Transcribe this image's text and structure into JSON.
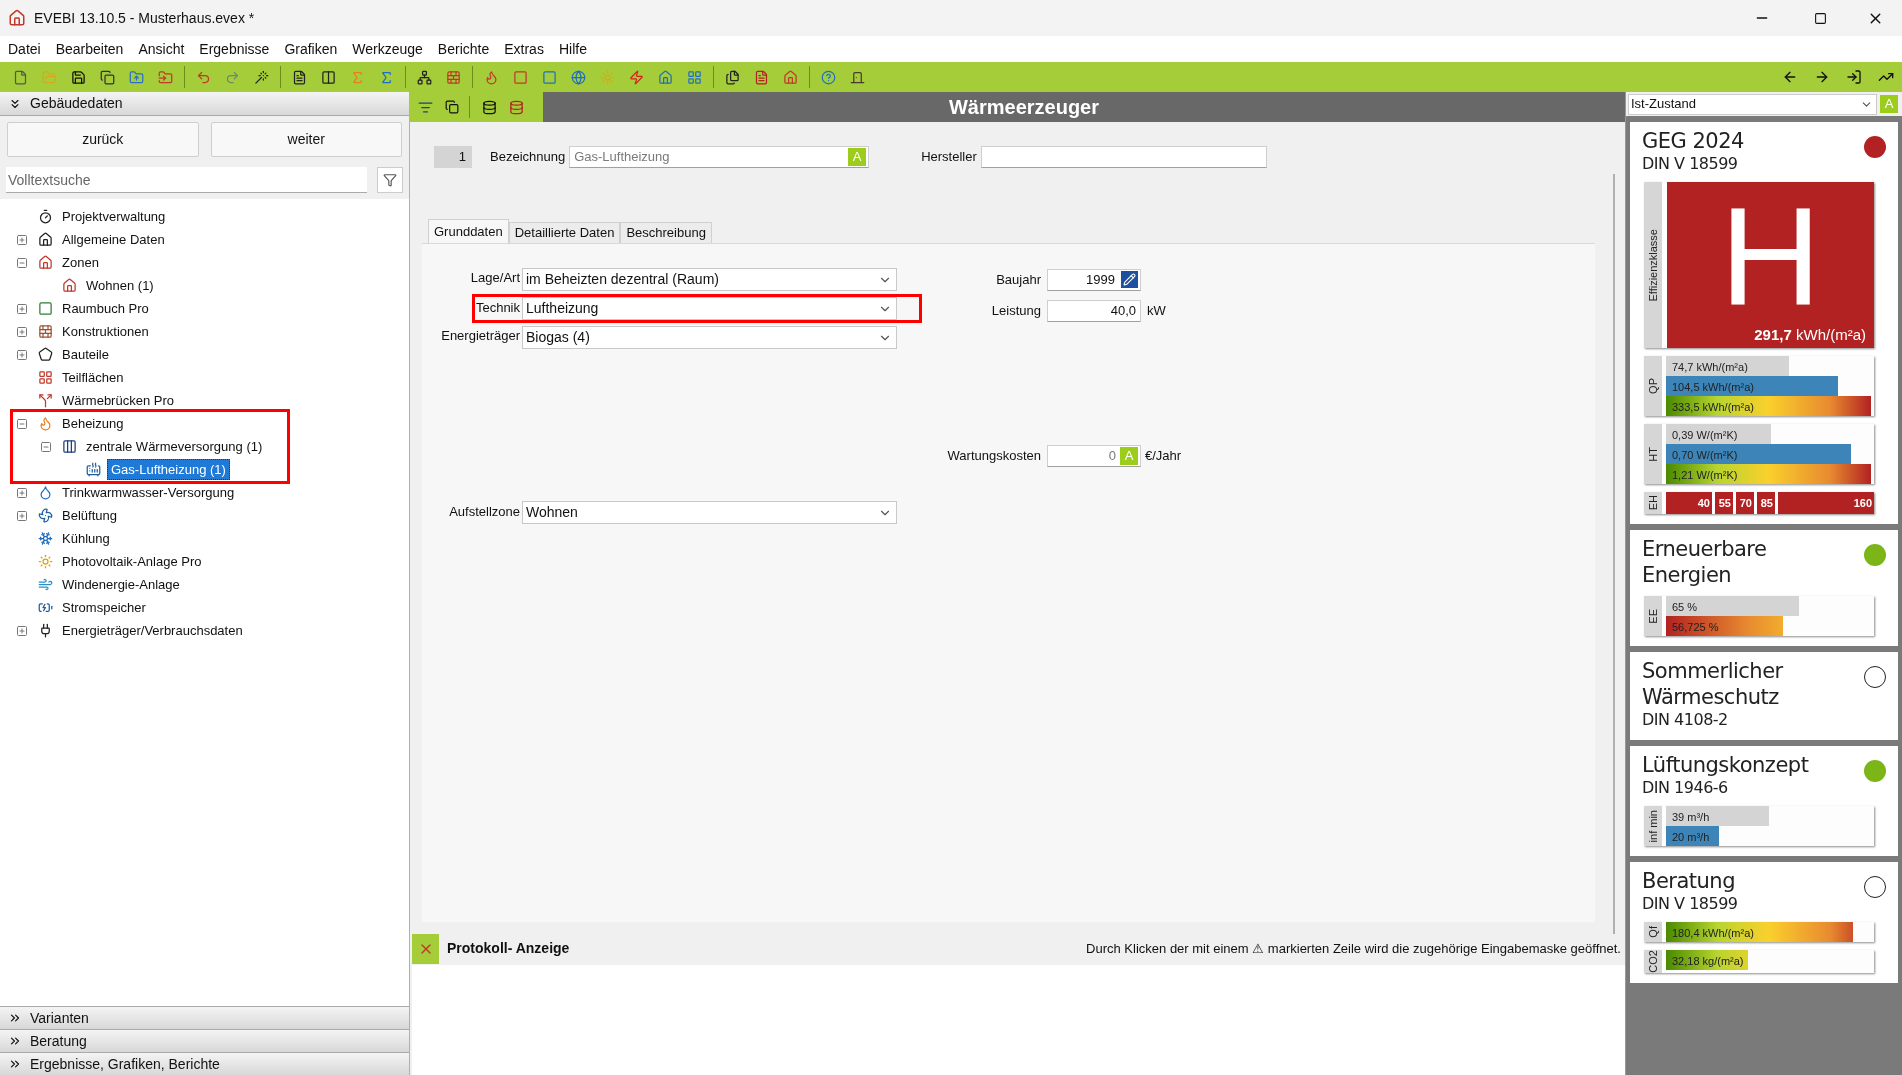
{
  "window": {
    "title": "EVEBI 13.10.5 - Musterhaus.evex *"
  },
  "menu": [
    "Datei",
    "Bearbeiten",
    "Ansicht",
    "Ergebnisse",
    "Grafiken",
    "Werkzeuge",
    "Berichte",
    "Extras",
    "Hilfe"
  ],
  "sidebar": {
    "header": "Gebäudedaten",
    "buttons": [
      "zurück",
      "weiter"
    ],
    "search": {
      "placeholder": "Volltextsuche"
    },
    "tree": [
      {
        "label": "Projektverwaltung",
        "selected": false,
        "highlighted": false
      },
      {
        "label": "Allgemeine Daten",
        "expanded": false,
        "selected": false,
        "highlighted": false
      },
      {
        "label": "Zonen",
        "expanded": true,
        "selected": false,
        "highlighted": false,
        "children": [
          {
            "label": "Wohnen (1)",
            "selected": false,
            "highlighted": false
          }
        ]
      },
      {
        "label": "Raumbuch Pro",
        "expanded": false,
        "selected": false,
        "highlighted": false
      },
      {
        "label": "Konstruktionen",
        "expanded": false,
        "selected": false,
        "highlighted": false
      },
      {
        "label": "Bauteile",
        "expanded": false,
        "selected": false,
        "highlighted": false
      },
      {
        "label": "Teilflächen",
        "selected": false,
        "highlighted": false
      },
      {
        "label": "Wärmebrücken Pro",
        "selected": false,
        "highlighted": false
      },
      {
        "label": "Beheizung",
        "expanded": true,
        "selected": false,
        "highlighted": true,
        "children": [
          {
            "label": "zentrale Wärmeversorgung (1)",
            "expanded": true,
            "selected": false,
            "highlighted": false,
            "children": [
              {
                "label": "Gas-Luftheizung (1)",
                "selected": true,
                "highlighted": false
              }
            ]
          }
        ]
      },
      {
        "label": "Trinkwarmwasser-Versorgung",
        "expanded": false,
        "selected": false,
        "highlighted": false
      },
      {
        "label": "Belüftung",
        "expanded": false,
        "selected": false,
        "highlighted": false
      },
      {
        "label": "Kühlung",
        "selected": false,
        "highlighted": false
      },
      {
        "label": "Photovoltaik-Anlage Pro",
        "selected": false,
        "highlighted": false
      },
      {
        "label": "Windenergie-Anlage",
        "selected": false,
        "highlighted": false
      },
      {
        "label": "Stromspeicher",
        "selected": false,
        "highlighted": false
      },
      {
        "label": "Energieträger/Verbrauchsdaten",
        "expanded": false,
        "selected": false,
        "highlighted": false
      }
    ],
    "sections": [
      "Varianten",
      "Beratung",
      "Ergebnisse, Grafiken, Berichte"
    ]
  },
  "editor": {
    "title": "Wärmeerzeuger",
    "number": "1",
    "name": {
      "label": "Bezeichnung",
      "value": "Gas-Luftheizung",
      "badge": "A"
    },
    "manufacturer": {
      "label": "Hersteller"
    },
    "tabs": [
      {
        "label": "Grunddaten",
        "selected": true
      },
      {
        "label": "Detaillierte Daten",
        "selected": false
      },
      {
        "label": "Beschreibung",
        "selected": false
      }
    ],
    "selects": [
      {
        "label": "Lage/Art",
        "value": "im Beheizten dezentral (Raum)",
        "highlighted": false
      },
      {
        "label": "Technik",
        "value": "Luftheizung",
        "highlighted": true
      },
      {
        "label": "Energieträger",
        "value": "Biogas (4)",
        "highlighted": false
      }
    ],
    "year": {
      "label": "Baujahr",
      "value": "1999"
    },
    "power": {
      "label": "Leistung",
      "value": "40,0",
      "unit": "kW"
    },
    "maintenance": {
      "label": "Wartungskosten",
      "value": "0",
      "badge": "A",
      "unit": "€/Jahr"
    },
    "zone": {
      "label": "Aufstellzone",
      "value": "Wohnen"
    }
  },
  "log": {
    "title": "Protokoll- Anzeige",
    "hint": "Durch Klicken der mit einem ⚠ markierten Zeile wird die zugehörige Eingabemaske geöffnet."
  },
  "results": {
    "variant": "Ist-Zustand",
    "badge": "A",
    "cards": [
      {
        "title": "GEG 2024",
        "subtitle": "DIN V 18599",
        "color": "#b22222",
        "class_label": "Effizienzklasse",
        "class": "H",
        "class_value": "**291,7** kWh/(m²a)",
        "groups": [
          {
            "label": "QP",
            "bars": [
              {
                "kind": "reference",
                "label": "74,7 kWh/(m²a)",
                "level": 0.6
              },
              {
                "kind": "actual",
                "label": "104,5 kWh/(m²a)",
                "level": 0.84
              },
              {
                "kind": "rising",
                "label": "333,5 kWh/(m²a)",
                "level": 1
              }
            ]
          },
          {
            "label": "HT",
            "bars": [
              {
                "kind": "reference",
                "label": "0,39 W/(m²K)",
                "level": 0.51
              },
              {
                "kind": "actual",
                "label": "0,70 W/(m²K)",
                "level": 0.9
              },
              {
                "kind": "rising",
                "label": "1,21 W/(m²K)",
                "level": 1
              }
            ]
          }
        ],
        "scale": {
          "label": "EH",
          "marks": [
            "40",
            "55",
            "70",
            "85",
            "160"
          ]
        }
      },
      {
        "title": "Erneuerbare Energien",
        "color": "#7cb518",
        "groups": [
          {
            "label": "EE",
            "bars": [
              {
                "kind": "reference",
                "label": "65 %",
                "level": 0.65
              },
              {
                "kind": "falling",
                "label": "56,725 %",
                "level": 0.57
              }
            ]
          }
        ]
      },
      {
        "title": "Sommerlicher Wärmeschutz",
        "subtitle": "DIN 4108-2"
      },
      {
        "title": "Lüftungskonzept",
        "subtitle": "DIN 1946-6",
        "color": "#7cb518",
        "groups": [
          {
            "label": "inf min",
            "bars": [
              {
                "kind": "reference",
                "label": "39 m³/h",
                "level": 0.5
              },
              {
                "kind": "actual",
                "label": "20 m³/h",
                "level": 0.26
              }
            ]
          }
        ]
      },
      {
        "title": "Beratung",
        "subtitle": "DIN V 18599",
        "groups": [
          {
            "label": "Qf",
            "bars": [
              {
                "kind": "rising",
                "label": "180,4 kWh/(m²a)",
                "level": 0.91
              }
            ]
          },
          {
            "label": "CO2",
            "bars": [
              {
                "kind": "rising",
                "label": "32,18 kg/(m²a)",
                "level": 0.4
              }
            ]
          }
        ]
      }
    ]
  }
}
